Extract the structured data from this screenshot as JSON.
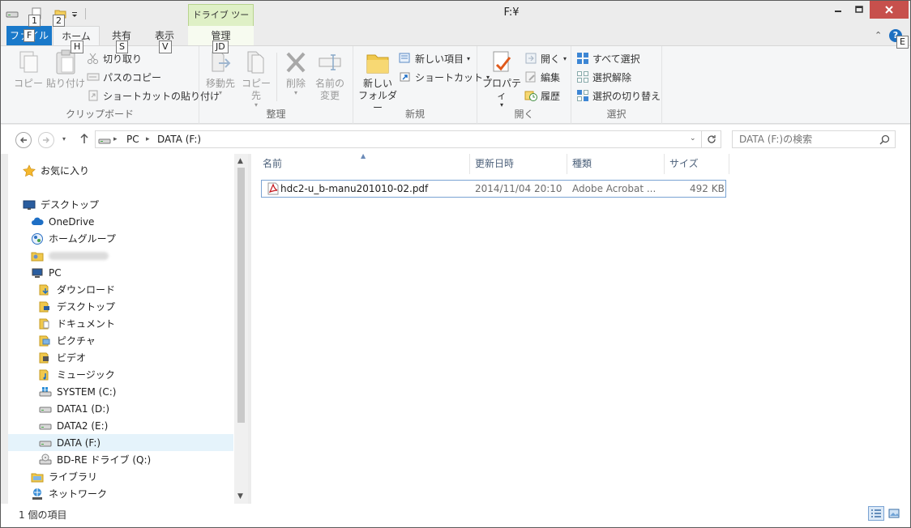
{
  "window": {
    "title": "F:¥",
    "context_tab_group": "ドライブ ツール"
  },
  "quick_access": {
    "keytips": [
      "1",
      "2"
    ]
  },
  "tabs": [
    {
      "label": "ファイル",
      "keytip": "F"
    },
    {
      "label": "ホーム",
      "keytip": "H"
    },
    {
      "label": "共有",
      "keytip": "S"
    },
    {
      "label": "表示",
      "keytip": "V"
    },
    {
      "label": "管理",
      "keytip": "JD"
    }
  ],
  "help_keytip": "E",
  "ribbon": {
    "clipboard": {
      "label": "クリップボード",
      "copy": "コピー",
      "paste": "貼り付け",
      "cut": "切り取り",
      "copy_path": "パスのコピー",
      "paste_shortcut": "ショートカットの貼り付け"
    },
    "organize": {
      "label": "整理",
      "move_to": "移動先",
      "copy_to": "コピー先",
      "delete": "削除",
      "rename_line1": "名前の",
      "rename_line2": "変更"
    },
    "new": {
      "label": "新規",
      "new_folder_line1": "新しい",
      "new_folder_line2": "フォルダー",
      "new_item": "新しい項目",
      "shortcut": "ショートカット"
    },
    "open": {
      "label": "開く",
      "properties": "プロパティ",
      "open": "開く",
      "edit": "編集",
      "history": "履歴"
    },
    "select": {
      "label": "選択",
      "select_all": "すべて選択",
      "select_none": "選択解除",
      "invert": "選択の切り替え"
    }
  },
  "address": {
    "crumbs": [
      "PC",
      "DATA (F:)"
    ]
  },
  "search": {
    "placeholder": "DATA (F:)の検索"
  },
  "nav": {
    "favorites": "お気に入り",
    "desktop": "デスクトップ",
    "onedrive": "OneDrive",
    "homegroup": "ホームグループ",
    "pc": "PC",
    "downloads": "ダウンロード",
    "pc_desktop": "デスクトップ",
    "documents": "ドキュメント",
    "pictures": "ピクチャ",
    "videos": "ビデオ",
    "music": "ミュージック",
    "system_c": "SYSTEM (C:)",
    "data1_d": "DATA1 (D:)",
    "data2_e": "DATA2 (E:)",
    "data_f": "DATA (F:)",
    "bdre_q": "BD-RE ドライブ (Q:)",
    "library": "ライブラリ",
    "network": "ネットワーク"
  },
  "columns": {
    "name": "名前",
    "date": "更新日時",
    "type": "種類",
    "size": "サイズ"
  },
  "files": [
    {
      "name": "hdc2-u_b-manu201010-02.pdf",
      "date": "2014/11/04 20:10",
      "type": "Adobe Acrobat ...",
      "size": "492 KB"
    }
  ],
  "status": {
    "item_count": "1 個の項目"
  },
  "colors": {
    "file_tab": "#1979ca",
    "close_button": "#c7504c",
    "context_tab": "#dff0c6",
    "selection": "#e5f3fb"
  }
}
